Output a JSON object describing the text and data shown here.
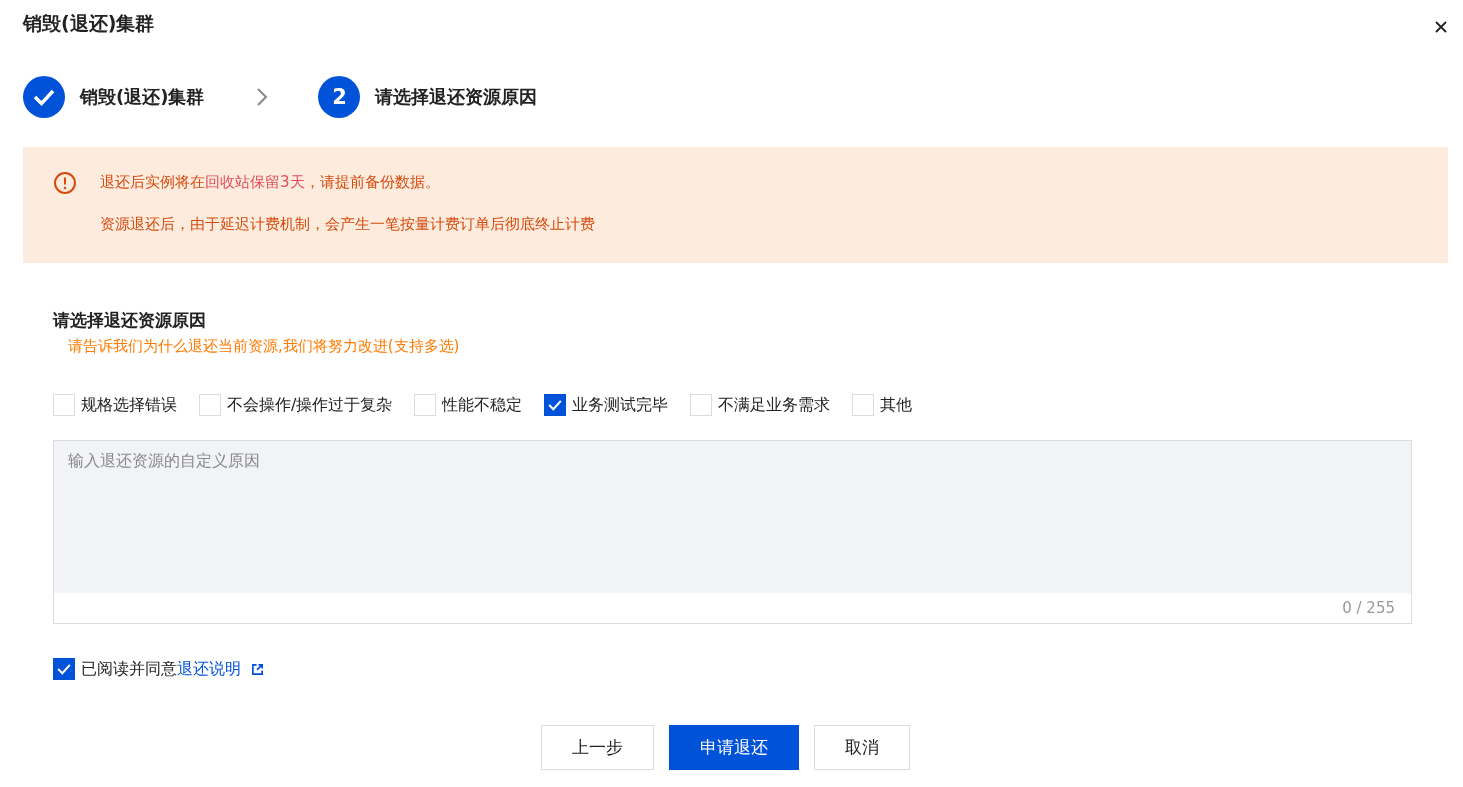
{
  "dialog": {
    "title": "销毁(退还)集群"
  },
  "steps": [
    {
      "done": true,
      "label": "销毁(退还)集群"
    },
    {
      "done": false,
      "number": "2",
      "label": "请选择退还资源原因"
    }
  ],
  "alert": {
    "line1": {
      "before": "退还后实例将在",
      "highlight": "回收站保留3天",
      "after": "，请提前备份数据。"
    },
    "line2": "资源退还后，由于延迟计费机制，会产生一笔按量计费订单后彻底终止计费"
  },
  "reasons": {
    "title": "请选择退还资源原因",
    "hint": "请告诉我们为什么退还当前资源,我们将努力改进(支持多选)",
    "options": [
      {
        "label": "规格选择错误",
        "checked": false
      },
      {
        "label": "不会操作/操作过于复杂",
        "checked": false
      },
      {
        "label": "性能不稳定",
        "checked": false
      },
      {
        "label": "业务测试完毕",
        "checked": true
      },
      {
        "label": "不满足业务需求",
        "checked": false
      },
      {
        "label": "其他",
        "checked": false
      }
    ],
    "textarea": {
      "placeholder": "输入退还资源的自定义原因",
      "counter": "0 / 255"
    }
  },
  "agreement": {
    "checked": true,
    "text": "已阅读并同意",
    "link": "退还说明"
  },
  "buttons": [
    {
      "label": "上一步",
      "kind": "default"
    },
    {
      "label": "申请退还",
      "kind": "primary"
    },
    {
      "label": "取消",
      "kind": "default"
    }
  ]
}
